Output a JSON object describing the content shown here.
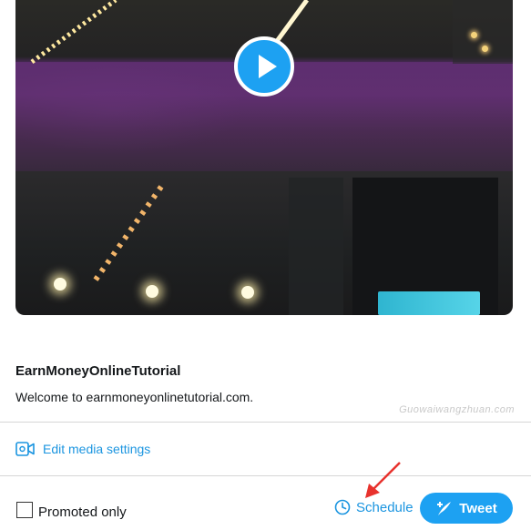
{
  "card": {
    "title": "EarnMoneyOnlineTutorial",
    "description": "Welcome to earnmoneyonlinetutorial.com."
  },
  "watermark": "Guowaiwangzhuan.com",
  "media": {
    "edit_label": "Edit media settings",
    "icon": "video-camera-icon"
  },
  "promoted": {
    "label": "Promoted only",
    "checked": false
  },
  "schedule": {
    "label": "Schedule",
    "icon": "clock-icon"
  },
  "tweet": {
    "label": "Tweet",
    "icon": "feather-plus-icon"
  },
  "colors": {
    "accent": "#1da1f2",
    "link": "#1b95e0",
    "annotation": "#e8322d"
  }
}
